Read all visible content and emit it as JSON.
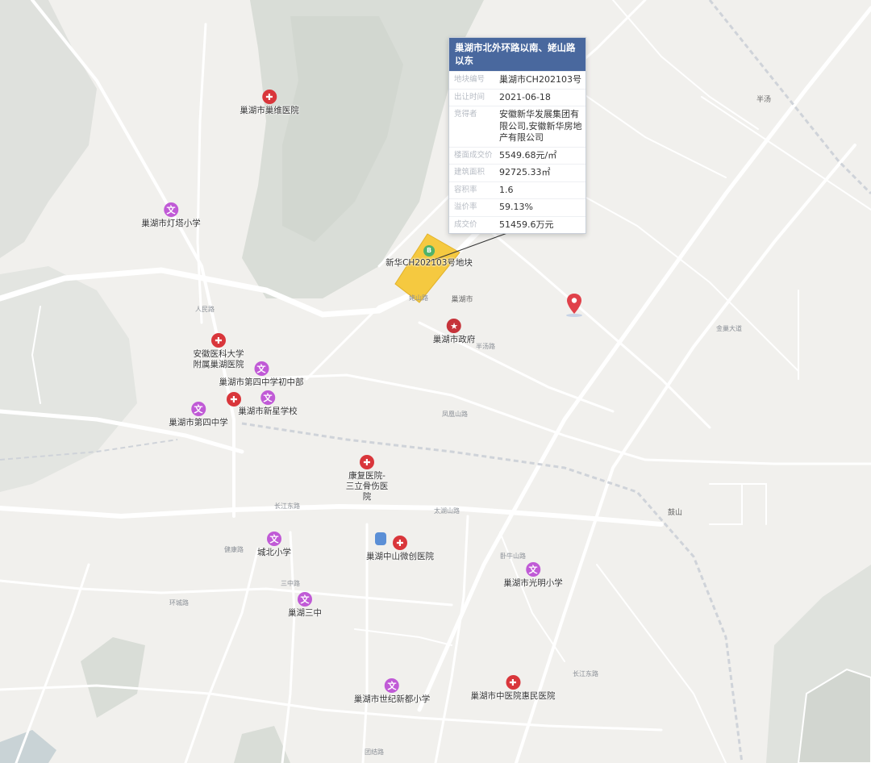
{
  "popup": {
    "title": "巢湖市北外环路以南、姥山路以东",
    "rows": [
      {
        "key": "地块编号",
        "value": "巢湖市CH202103号"
      },
      {
        "key": "出让时间",
        "value": "2021-06-18"
      },
      {
        "key": "竞得者",
        "value": "安徽新华发展集团有限公司,安徽新华房地产有限公司"
      },
      {
        "key": "楼面成交价",
        "value": "5549.68元/㎡"
      },
      {
        "key": "建筑面积",
        "value": "92725.33㎡"
      },
      {
        "key": "容积率",
        "value": "1.6"
      },
      {
        "key": "溢价率",
        "value": "59.13%"
      },
      {
        "key": "成交价",
        "value": "51459.6万元"
      }
    ]
  },
  "parcel": {
    "label": "新华CH202103号地块",
    "color": "#f5c940",
    "icon": "land-icon"
  },
  "pois": {
    "hospital_chaowei": "巢湖市巢维医院",
    "school_dengta": "巢湖市灯塔小学",
    "gov": "巢湖市政府",
    "area_chaohu": "巢湖市",
    "hospital_anyi": "安徽医科大学附属巢湖医院",
    "school_sizhong_chu": "巢湖市第四中学初中部",
    "school_xinxing": "巢湖市新星学校",
    "school_sizhong": "巢湖市第四中学",
    "hospital_kangfu": "康复医院-三立骨伤医院",
    "school_chengbei": "城北小学",
    "hospital_zhongshan": "巢湖中山微创医院",
    "school_guangming": "巢湖市光明小学",
    "school_sanzhong": "巢湖三中",
    "school_shiji": "巢湖市世纪新都小学",
    "hospital_zhongyi": "巢湖市中医院惠民医院"
  },
  "places": {
    "banshang": "半汤",
    "gushan": "鼓山"
  },
  "roads": [
    "长江东路",
    "太湖山路",
    "三中路",
    "环城路",
    "团结路",
    "凤凰山路",
    "半汤路",
    "姥山路",
    "健康路",
    "人民路",
    "卧牛山路",
    "金巢大道",
    "长江东路"
  ],
  "colors": {
    "hospital": "#d9363b",
    "school": "#c05ad6",
    "popup_header": "#49689e",
    "parcel": "#f5c940",
    "pin": "#e0414a"
  }
}
